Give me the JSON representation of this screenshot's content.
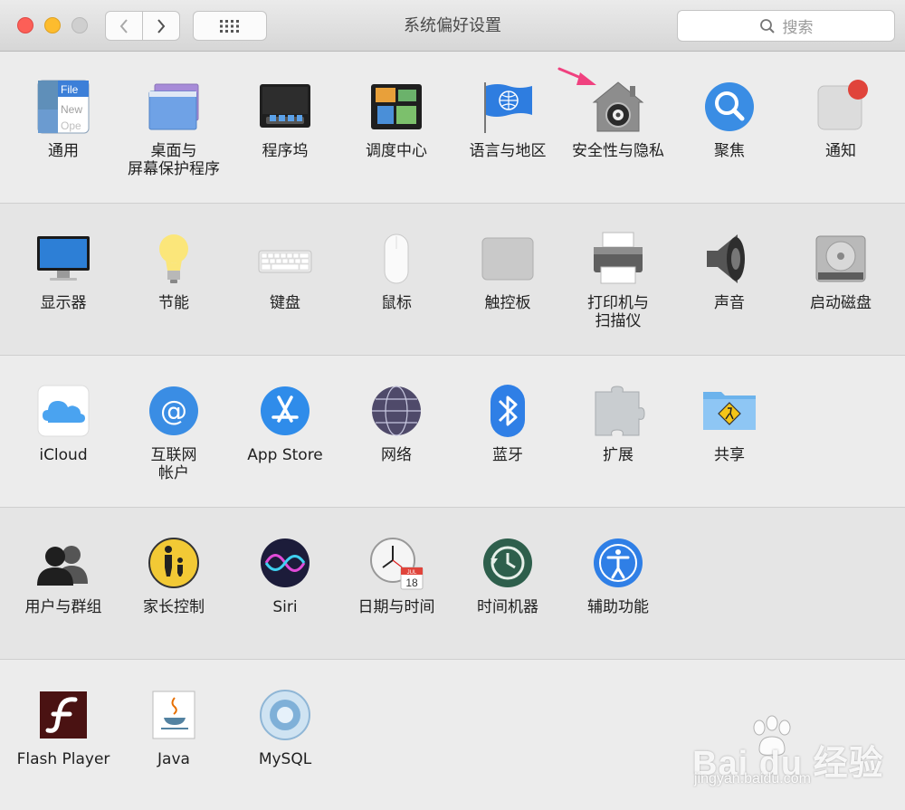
{
  "window": {
    "title": "系统偏好设置"
  },
  "toolbar": {
    "back_icon": "chevron-left-icon",
    "forward_icon": "chevron-right-icon",
    "show_all_icon": "grid-icon",
    "search_placeholder": "搜索"
  },
  "sections": [
    {
      "panes": [
        {
          "name": "general",
          "label": [
            "通用"
          ],
          "icon": "general-icon"
        },
        {
          "name": "desktop-screensaver",
          "label": [
            "桌面与",
            "屏幕保护程序"
          ],
          "icon": "desktop-icon"
        },
        {
          "name": "dock",
          "label": [
            "程序坞"
          ],
          "icon": "dock-icon"
        },
        {
          "name": "mission-control",
          "label": [
            "调度中心"
          ],
          "icon": "mission-control-icon"
        },
        {
          "name": "language-region",
          "label": [
            "语言与地区"
          ],
          "icon": "flag-globe-icon"
        },
        {
          "name": "security-privacy",
          "label": [
            "安全性与隐私"
          ],
          "icon": "security-house-icon"
        },
        {
          "name": "spotlight",
          "label": [
            "聚焦"
          ],
          "icon": "spotlight-icon"
        },
        {
          "name": "notifications",
          "label": [
            "通知"
          ],
          "icon": "notifications-icon"
        }
      ]
    },
    {
      "panes": [
        {
          "name": "displays",
          "label": [
            "显示器"
          ],
          "icon": "display-icon"
        },
        {
          "name": "energy-saver",
          "label": [
            "节能"
          ],
          "icon": "lightbulb-icon"
        },
        {
          "name": "keyboard",
          "label": [
            "键盘"
          ],
          "icon": "keyboard-icon"
        },
        {
          "name": "mouse",
          "label": [
            "鼠标"
          ],
          "icon": "mouse-icon"
        },
        {
          "name": "trackpad",
          "label": [
            "触控板"
          ],
          "icon": "trackpad-icon"
        },
        {
          "name": "printers-scanners",
          "label": [
            "打印机与",
            "扫描仪"
          ],
          "icon": "printer-icon"
        },
        {
          "name": "sound",
          "label": [
            "声音"
          ],
          "icon": "speaker-icon"
        },
        {
          "name": "startup-disk",
          "label": [
            "启动磁盘"
          ],
          "icon": "disk-icon"
        }
      ]
    },
    {
      "panes": [
        {
          "name": "icloud",
          "label": [
            "iCloud"
          ],
          "icon": "cloud-icon"
        },
        {
          "name": "internet-accounts",
          "label": [
            "互联网",
            "帐户"
          ],
          "icon": "at-sign-icon"
        },
        {
          "name": "app-store",
          "label": [
            "App Store"
          ],
          "icon": "app-store-icon"
        },
        {
          "name": "network",
          "label": [
            "网络"
          ],
          "icon": "network-globe-icon"
        },
        {
          "name": "bluetooth",
          "label": [
            "蓝牙"
          ],
          "icon": "bluetooth-icon"
        },
        {
          "name": "extensions",
          "label": [
            "扩展"
          ],
          "icon": "puzzle-icon"
        },
        {
          "name": "sharing",
          "label": [
            "共享"
          ],
          "icon": "sharing-folder-icon"
        }
      ]
    },
    {
      "panes": [
        {
          "name": "users-groups",
          "label": [
            "用户与群组"
          ],
          "icon": "users-icon"
        },
        {
          "name": "parental-controls",
          "label": [
            "家长控制"
          ],
          "icon": "parental-icon"
        },
        {
          "name": "siri",
          "label": [
            "Siri"
          ],
          "icon": "siri-icon"
        },
        {
          "name": "date-time",
          "label": [
            "日期与时间"
          ],
          "icon": "clock-calendar-icon"
        },
        {
          "name": "time-machine",
          "label": [
            "时间机器"
          ],
          "icon": "time-machine-icon"
        },
        {
          "name": "accessibility",
          "label": [
            "辅助功能"
          ],
          "icon": "accessibility-icon"
        }
      ]
    },
    {
      "panes": [
        {
          "name": "flash-player",
          "label": [
            "Flash Player"
          ],
          "icon": "flash-icon"
        },
        {
          "name": "java",
          "label": [
            "Java"
          ],
          "icon": "java-cup-icon"
        },
        {
          "name": "mysql",
          "label": [
            "MySQL"
          ],
          "icon": "mysql-icon"
        }
      ]
    }
  ],
  "calendar_icon_text": {
    "month": "JUL",
    "day": "18"
  },
  "annotation": {
    "icon": "pink-arrow-icon"
  },
  "watermark": {
    "brand": "Bai du 经验",
    "url": "jingyan.baidu.com"
  },
  "colors": {
    "annotation_arrow": "#f0417f",
    "close": "#fc5f57",
    "minimize": "#fdbc2e",
    "accent_blue": "#2f7fe6"
  }
}
